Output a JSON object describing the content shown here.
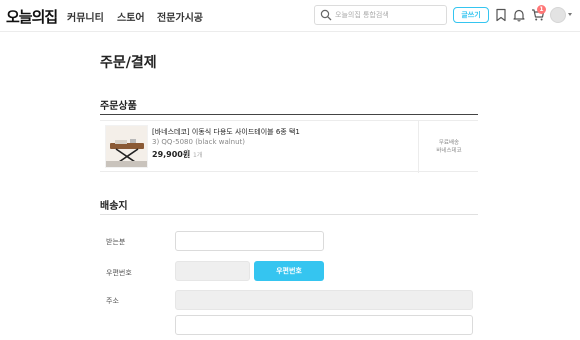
{
  "header": {
    "logo": "오늘의집",
    "nav": [
      "커뮤니티",
      "스토어",
      "전문가시공"
    ],
    "search": {
      "placeholder": "오늘의집 통합검색"
    },
    "write_label": "글쓰기",
    "cart_count": "1",
    "icons": [
      "bookmark-icon",
      "bell-icon",
      "cart-icon",
      "search-icon"
    ],
    "accent": "#35c5f0"
  },
  "page": {
    "title": "주문/결제"
  },
  "order_products": {
    "section_title": "주문상품",
    "item": {
      "name": "[바네스데코] 이동식 다용도 사이드테이블 6종 택1",
      "option": "3) QQ-5080 (black walnut)",
      "price": "29,900원",
      "qty": "1개",
      "shipping_fee": "무료배송",
      "seller": "바네스데코"
    }
  },
  "shipping": {
    "section_title": "배송지",
    "recipient_label": "받는분",
    "zip_label": "우편번호",
    "zip_button": "우편번호",
    "address_label": "주소"
  }
}
